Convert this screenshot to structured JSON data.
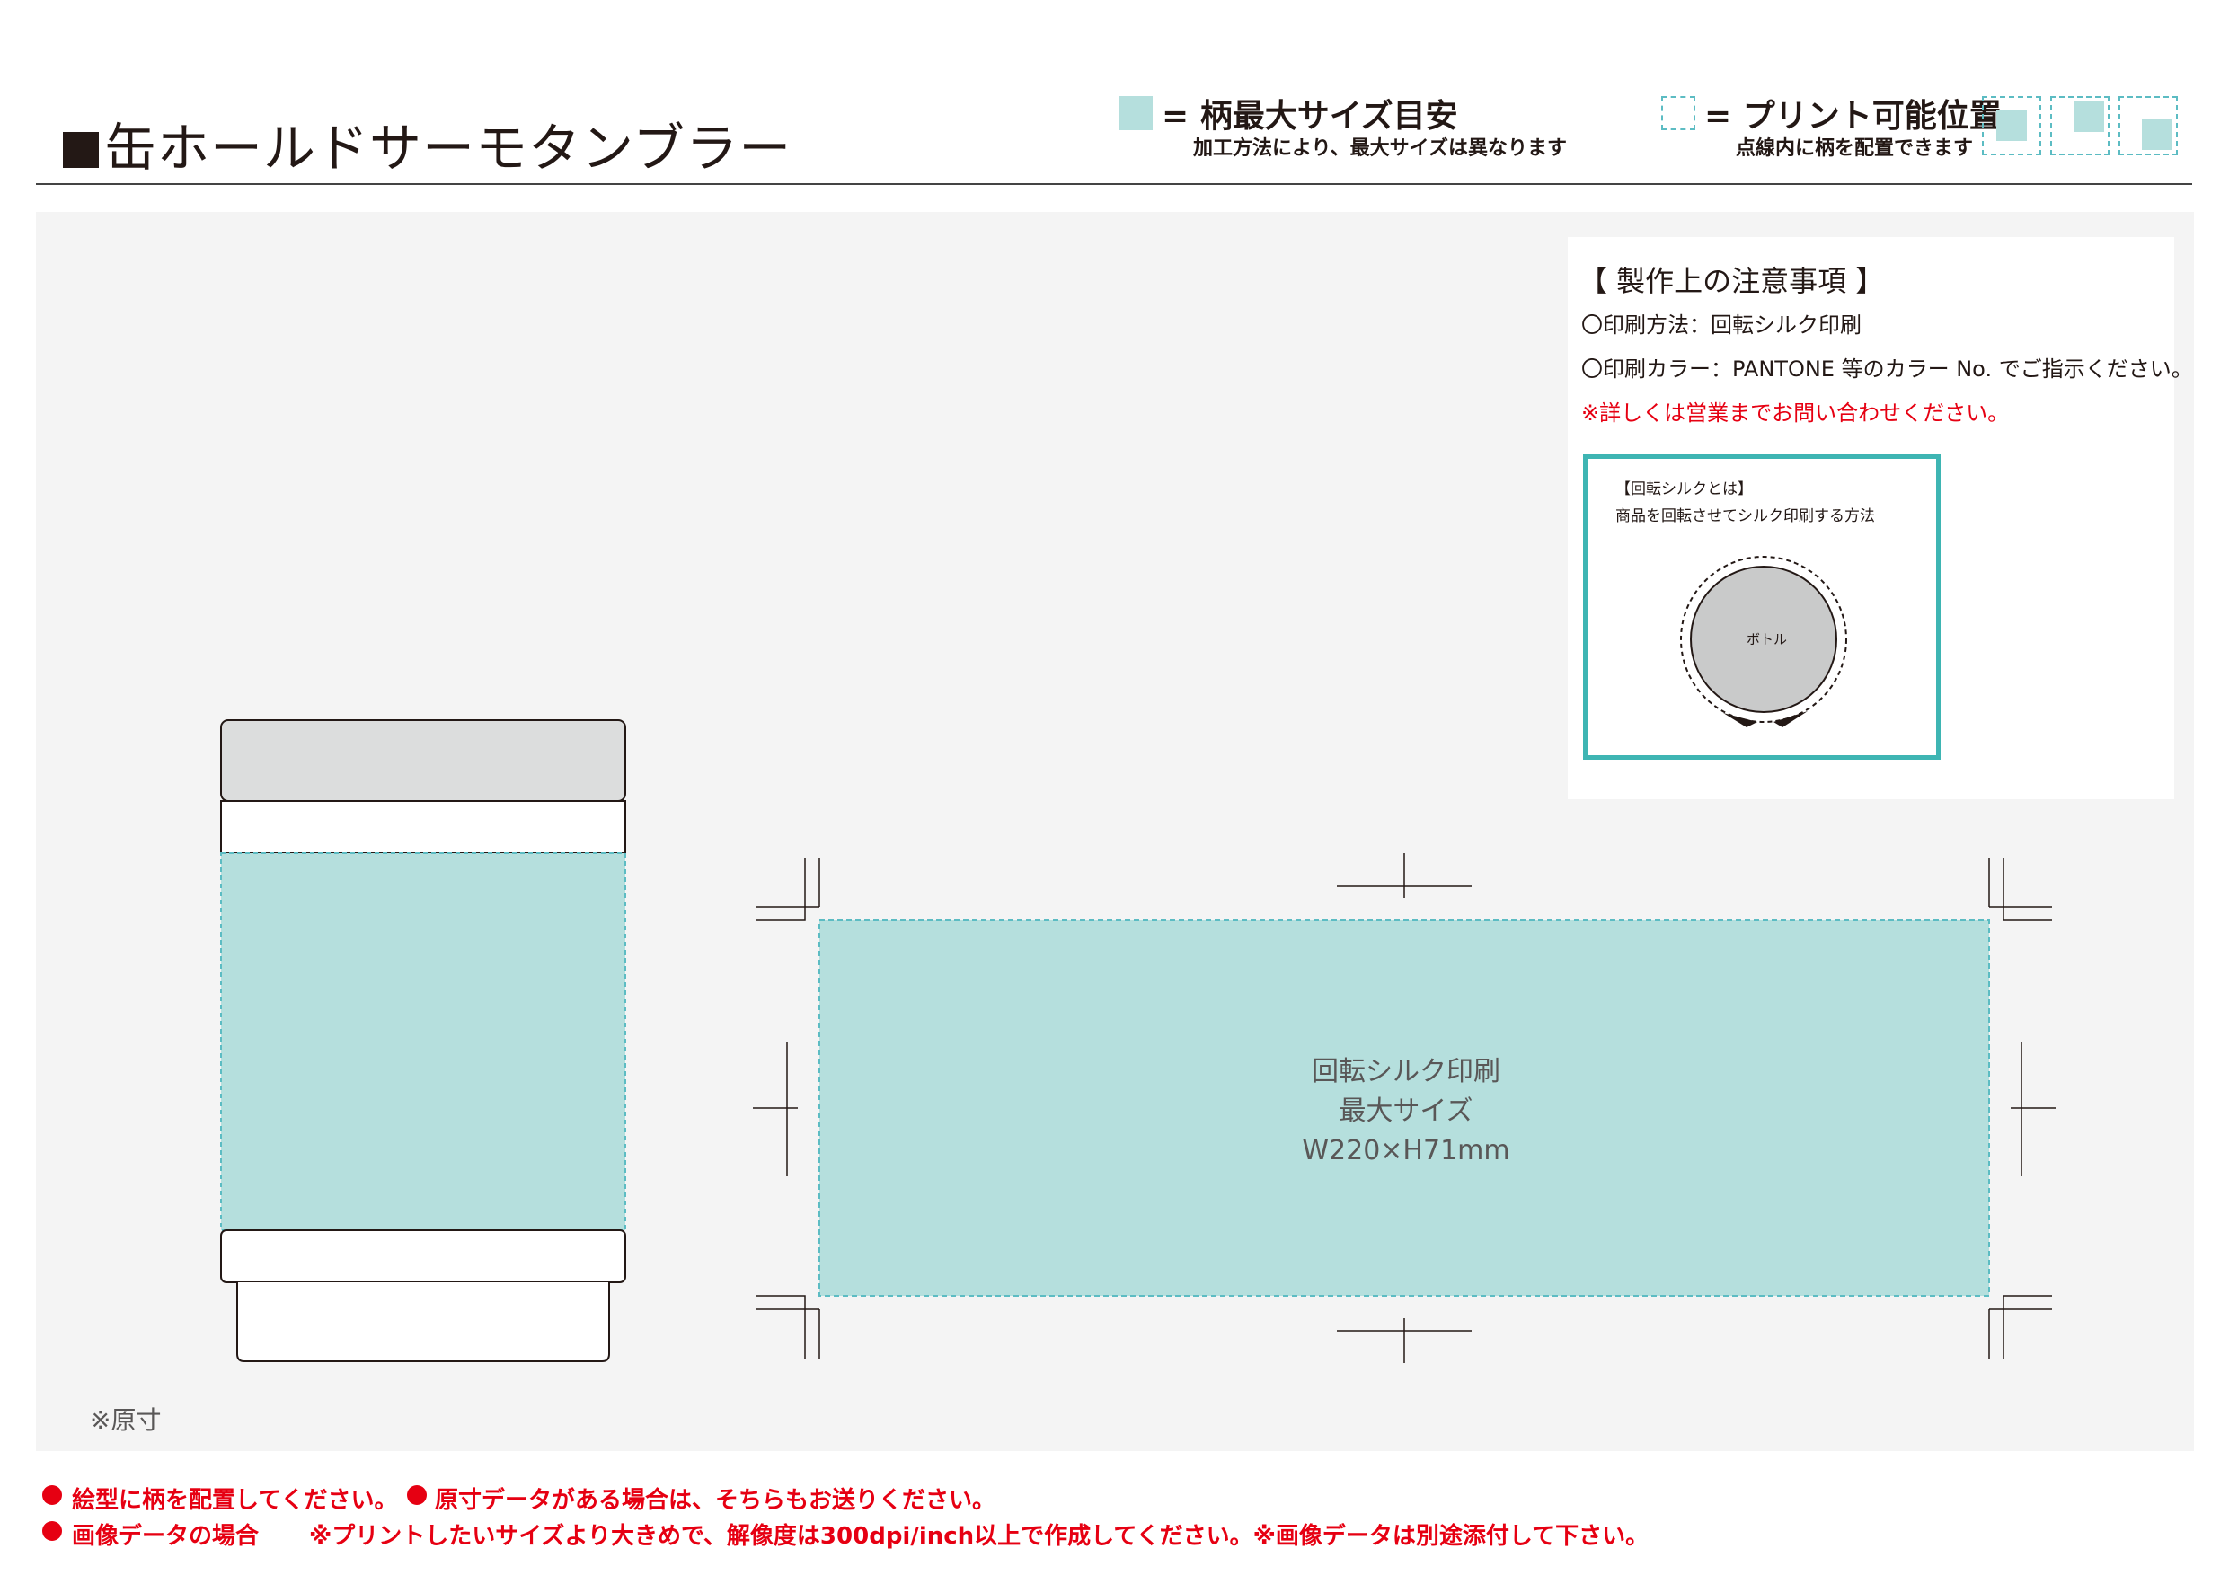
{
  "header": {
    "title": "缶ホールドサーモタンブラー",
    "legend_max_area": {
      "label": "= 柄最大サイズ目安",
      "sub": "加工方法により、最大サイズは異なります"
    },
    "legend_print_pos": {
      "label": "= プリント可能位置",
      "sub": "点線内に柄を配置できます"
    }
  },
  "notes": {
    "title": "【 製作上の注意事項 】",
    "items": [
      "〇印刷方法：回転シルク印刷",
      "〇印刷カラー：PANTONE 等のカラー No. でご指示ください。"
    ],
    "warning": "※詳しくは営業までお問い合わせください。",
    "silk_box": {
      "title": "【回転シルクとは】",
      "desc": "商品を回転させてシルク印刷する方法",
      "bottle_label": "ボトル"
    }
  },
  "print_area": {
    "method": "回転シルク印刷",
    "size_label": "最大サイズ",
    "dimensions": "W220×H71mm"
  },
  "scale_note": "※原寸",
  "footer": {
    "line1_a": "絵型に柄を配置してください。",
    "line1_b": "原寸データがある場合は、そちらもお送りください。",
    "line2_a": "画像データの場合",
    "line2_b": "※プリントしたいサイズより大きめで、解像度は300dpi/inch以上で作成してください。※画像データは別途添付して下さい。"
  },
  "colors": {
    "print_fill": "#b5dfdd",
    "dashed": "#5cbcc3",
    "frame": "#3eb5b3",
    "warning": "#e60012",
    "panel": "#f4f4f4"
  }
}
